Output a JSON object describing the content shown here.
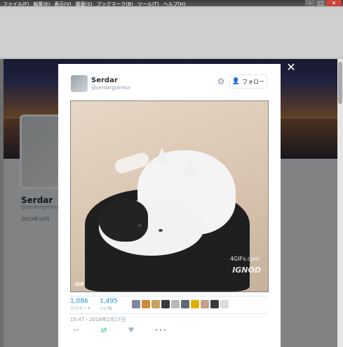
{
  "window": {
    "menu": [
      "ファイル(F)",
      "編集(E)",
      "表示(V)",
      "履歴(S)",
      "ブックマーク(B)",
      "ツール(T)",
      "ヘルプ(H)"
    ],
    "controls": [
      "–",
      "□",
      "✕"
    ]
  },
  "background_profile": {
    "name": "Serdar",
    "handle": "@serdargokmur",
    "joined": "2013年10月"
  },
  "modal": {
    "close": "✕",
    "author": {
      "name": "Serdar",
      "handle": "@serdargokmur"
    },
    "follow_label": "フォロー",
    "media": {
      "badge": "GIF",
      "watermark_top": "4GIFs.com",
      "watermark_bottom": "IGNOD"
    },
    "stats": {
      "retweets": {
        "value": "1,086",
        "label": "リツイート"
      },
      "likes": {
        "value": "1,495",
        "label": "いいね"
      }
    },
    "liker_colors": [
      "#7f8aa0",
      "#d18a3a",
      "#c9a060",
      "#3a3a3a",
      "#b9b9b9",
      "#5f6a79",
      "#e0b200",
      "#c2a18d",
      "#3b3b3b",
      "#dcdcdc"
    ],
    "timestamp": "15:47 - 2016年2月17日",
    "actions": {
      "reply_icon": "↩",
      "retweet_icon": "⇄",
      "like_icon": "♥",
      "more_icon": "•••"
    }
  }
}
